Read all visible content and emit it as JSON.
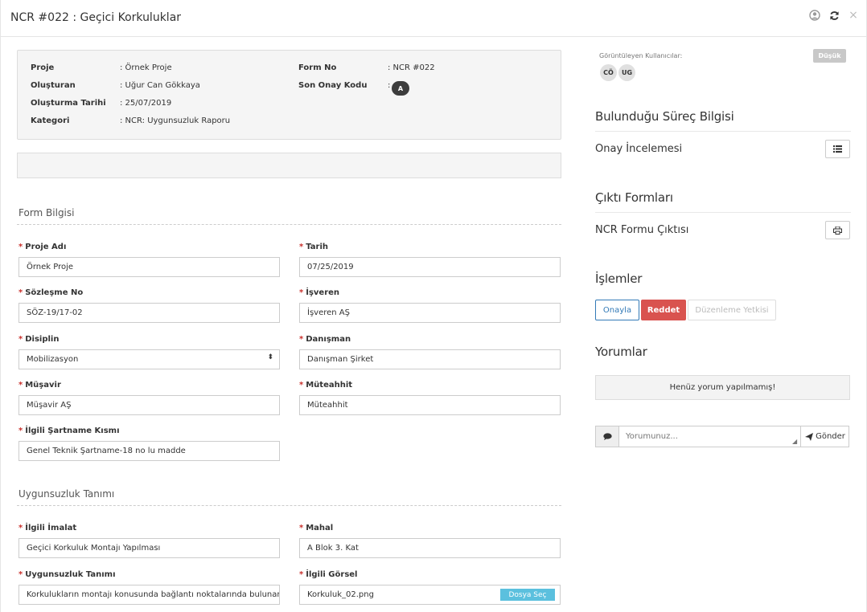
{
  "header": {
    "title": "NCR #022 : Geçici Korkuluklar",
    "close": "×"
  },
  "info": {
    "proje_label": "Proje",
    "proje_value": ": Örnek Proje",
    "olusturan_label": "Oluşturan",
    "olusturan_value": ": Uğur Can Gökkaya",
    "tarih_label": "Oluşturma Tarihi",
    "tarih_value": ": 25/07/2019",
    "kategori_label": "Kategori",
    "kategori_value": ": NCR: Uygunsuzluk Raporu",
    "formno_label": "Form No",
    "formno_value": ": NCR #022",
    "onay_label": "Son Onay Kodu",
    "onay_colon": ":",
    "onay_badge": "A"
  },
  "form": {
    "section1": "Form Bilgisi",
    "proje_adi_label": "Proje Adı",
    "proje_adi_value": "Örnek Proje",
    "tarih_label": "Tarih",
    "tarih_value": "07/25/2019",
    "sozlesme_label": "Sözleşme No",
    "sozlesme_value": "SÖZ-19/17-02",
    "isveren_label": "İşveren",
    "isveren_value": "İşveren AŞ",
    "disiplin_label": "Disiplin",
    "disiplin_value": "Mobilizasyon",
    "danisman_label": "Danışman",
    "danisman_value": "Danışman Şirket",
    "musavir_label": "Müşavir",
    "musavir_value": "Müşavir AŞ",
    "muteahhit_label": "Müteahhit",
    "muteahhit_value": "Müteahhit",
    "sartname_label": "İlgili Şartname Kısmı",
    "sartname_value": "Genel Teknik Şartname-18 no lu madde",
    "section2": "Uygunsuzluk Tanımı",
    "imalat_label": "İlgili İmalat",
    "imalat_value": "Geçici Korkuluk Montajı Yapılması",
    "mahal_label": "Mahal",
    "mahal_value": "A Blok 3. Kat",
    "tanim_label": "Uygunsuzluk Tanımı",
    "tanim_value": "Korkulukların montajı konusunda bağlantı noktalarında bulunan",
    "gorsel_label": "İlgili Görsel",
    "gorsel_value": "Korkuluk_02.png",
    "dosya_sec": "Dosya Seç",
    "req_mark": "*"
  },
  "side": {
    "viewers_label": "Görüntüleyen Kullanıcılar:",
    "priority": "Düşük",
    "avatars": [
      "CÖ",
      "UG"
    ],
    "surec_title": "Bulunduğu Süreç Bilgisi",
    "surec_item": "Onay İncelemesi",
    "cikti_title": "Çıktı Formları",
    "cikti_item": "NCR Formu Çıktısı",
    "islemler_title": "İşlemler",
    "onayla": "Onayla",
    "reddet": "Reddet",
    "duzenleme": "Düzenleme Yetkisi",
    "yorumlar_title": "Yorumlar",
    "no_comment": "Henüz yorum yapılmamış!",
    "comment_placeholder": "Yorumunuz...",
    "gonder": "Gönder"
  },
  "colors": {
    "danger": "#d9534f",
    "info": "#5bc0de",
    "primary": "#337ab7"
  },
  "icons": [
    "user-circle-icon",
    "refresh-icon",
    "close-icon",
    "list-icon",
    "print-icon",
    "comment-icon",
    "send-icon",
    "select-arrows-icon"
  ]
}
